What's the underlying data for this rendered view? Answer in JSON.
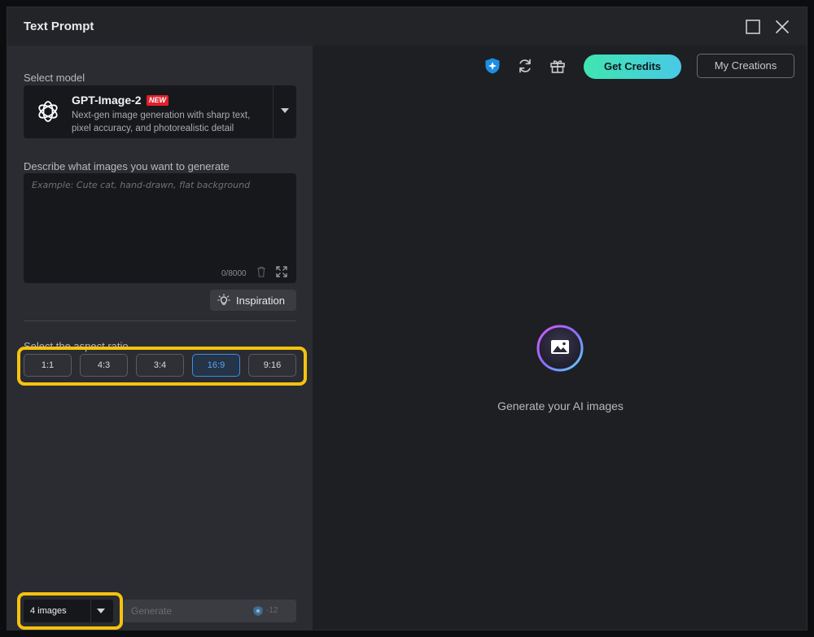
{
  "window": {
    "title": "Text Prompt"
  },
  "model_section": {
    "label": "Select model",
    "name": "GPT-Image-2",
    "badge": "NEW",
    "description": "Next-gen image generation with sharp text, pixel accuracy, and photorealistic detail"
  },
  "prompt_section": {
    "label": "Describe what images you want to generate",
    "value": "",
    "placeholder": "Example: Cute cat, hand-drawn, flat background",
    "counter": "0/8000"
  },
  "inspiration_label": "Inspiration",
  "aspect_section": {
    "label": "Select the aspect ratio",
    "options": [
      "1:1",
      "4:3",
      "3:4",
      "16:9",
      "9:16"
    ],
    "selected": "16:9"
  },
  "image_count": {
    "selected": "4 images"
  },
  "generate": {
    "label": "Generate",
    "cost": "-12"
  },
  "toolbar": {
    "icons": [
      "shield-star-icon",
      "refresh-icon",
      "gift-icon"
    ],
    "get_credits": "Get Credits",
    "my_creations": "My Creations"
  },
  "empty_state": {
    "icon": "image-orb-icon",
    "text": "Generate your AI images"
  },
  "colors": {
    "accent_selected": "#3c8ee8",
    "credits_gradient_start": "#3fe5b0",
    "credits_gradient_end": "#49c9e6",
    "new_badge": "#e0202e",
    "highlight": "#f6c20f"
  }
}
